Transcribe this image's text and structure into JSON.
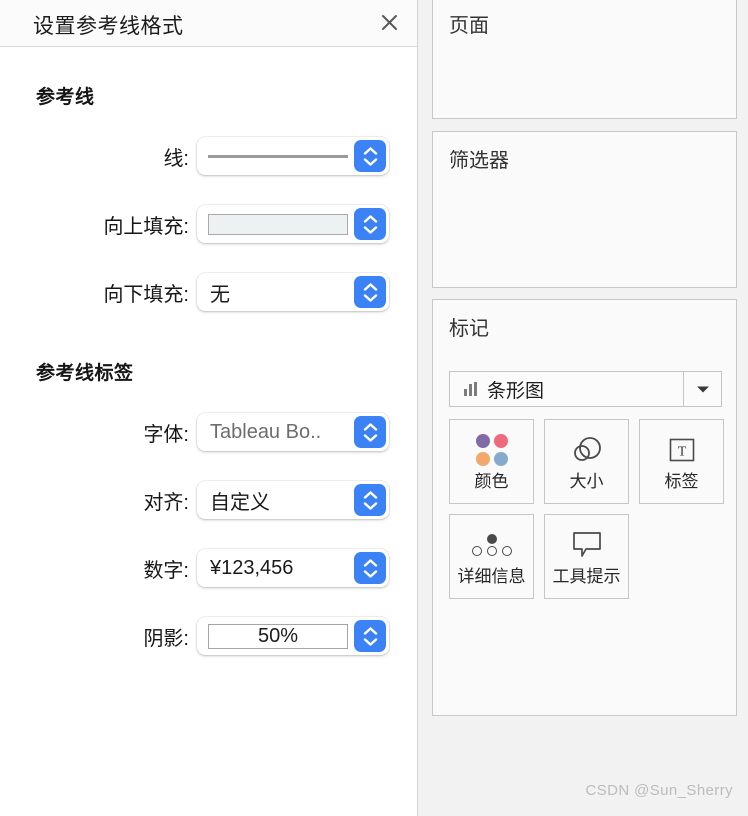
{
  "format_panel": {
    "title": "设置参考线格式",
    "close_icon": "close-icon",
    "sections": {
      "refline": {
        "heading": "参考线",
        "fields": [
          {
            "label": "线:",
            "value": "",
            "control": "line-swatch"
          },
          {
            "label": "向上填充:",
            "value": "",
            "control": "fill-swatch"
          },
          {
            "label": "向下填充:",
            "value": "无",
            "control": "text"
          }
        ]
      },
      "refline_label": {
        "heading": "参考线标签",
        "fields": [
          {
            "label": "字体:",
            "value": "Tableau Bo..",
            "control": "text-muted"
          },
          {
            "label": "对齐:",
            "value": "自定义",
            "control": "text"
          },
          {
            "label": "数字:",
            "value": "¥123,456",
            "control": "text"
          },
          {
            "label": "阴影:",
            "value": "50%",
            "control": "inner-field"
          }
        ]
      }
    },
    "stepper_icon": "stepper-up-down-icon"
  },
  "shelf": {
    "pages_card": {
      "title": "页面"
    },
    "filters_card": {
      "title": "筛选器"
    },
    "marks_card": {
      "title": "标记",
      "mark_type": {
        "label": "条形图",
        "icon": "bar-chart-icon",
        "arrow_icon": "chevron-down-icon"
      },
      "buttons": [
        {
          "label": "颜色",
          "icon": "color-dots-icon"
        },
        {
          "label": "大小",
          "icon": "size-circles-icon"
        },
        {
          "label": "标签",
          "icon": "label-t-icon"
        },
        {
          "label": "详细信息",
          "icon": "detail-dots-icon"
        },
        {
          "label": "工具提示",
          "icon": "tooltip-bubble-icon"
        }
      ]
    }
  },
  "watermark": "CSDN @Sun_Sherry",
  "colors": {
    "accent_blue": "#3b82f7",
    "dot_purple": "#7f6ba6",
    "dot_pink": "#ef6a7f",
    "dot_orange": "#f0a濃",
    "dot_blue": "#84aacf"
  }
}
